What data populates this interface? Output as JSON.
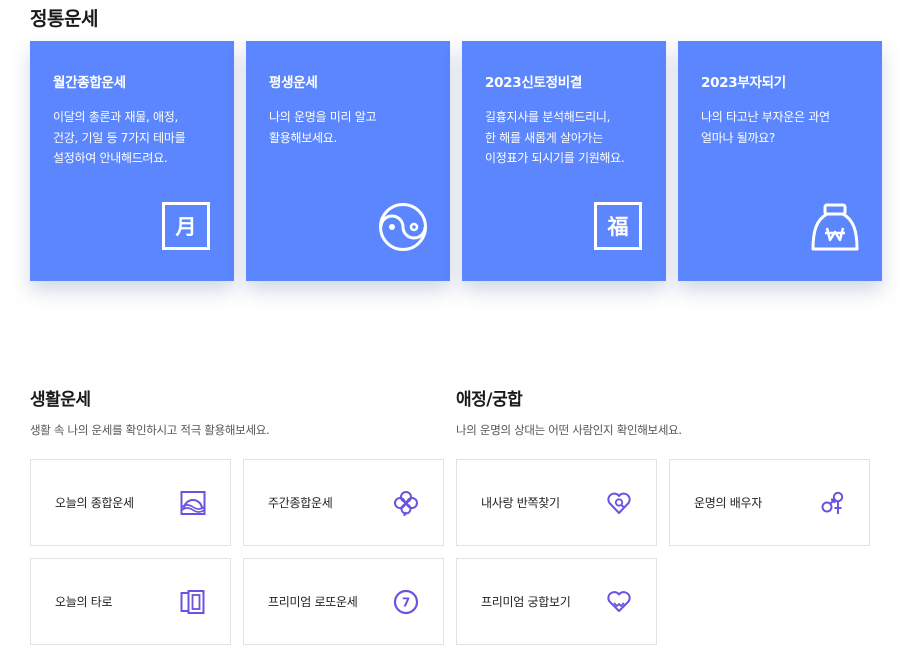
{
  "title": "정통운세",
  "cards": [
    {
      "title": "월간종합운세",
      "desc": "이달의 총론과 재물, 애정,\n건강, 기일 등 7가지 테마를\n설정하여 안내해드려요.",
      "icon": "calendar-month-icon",
      "glyph": "月"
    },
    {
      "title": "평생운세",
      "desc": "나의 운명을 미리 알고\n활용해보세요.",
      "icon": "yin-yang-icon"
    },
    {
      "title": "2023신토정비결",
      "desc": "길흉지사를 분석해드리니,\n한 해를 새롭게 살아가는\n이정표가 되시기를 기원해요.",
      "icon": "fortune-bok-icon",
      "glyph": "福"
    },
    {
      "title": "2023부자되기",
      "desc": "나의 타고난 부자운은 과연\n얼마나 될까요?",
      "icon": "money-bag-icon"
    }
  ],
  "life": {
    "title": "생활운세",
    "subtitle": "생활 속 나의 운세를 확인하시고 적극 활용해보세요.",
    "items": [
      {
        "label": "오늘의 종합운세",
        "icon": "sunrise-icon"
      },
      {
        "label": "주간종합운세",
        "icon": "clover-icon"
      },
      {
        "label": "오늘의 타로",
        "icon": "tarot-cards-icon"
      },
      {
        "label": "프리미엄 로또운세",
        "icon": "lotto-ball-icon",
        "glyph": "7"
      }
    ]
  },
  "love": {
    "title": "애정/궁합",
    "subtitle": "나의 운명의 상대는 어떤 사람인지 확인해보세요.",
    "items": [
      {
        "label": "내사랑 반쪽찾기",
        "icon": "heart-search-icon"
      },
      {
        "label": "운명의 배우자",
        "icon": "gender-symbols-icon"
      },
      {
        "label": "프리미엄 궁합보기",
        "icon": "heart-hands-icon"
      }
    ]
  },
  "colors": {
    "card_bg": "#5b86fd",
    "icon_purple": "#6b52e0",
    "tile_border": "#e2e2e2"
  }
}
